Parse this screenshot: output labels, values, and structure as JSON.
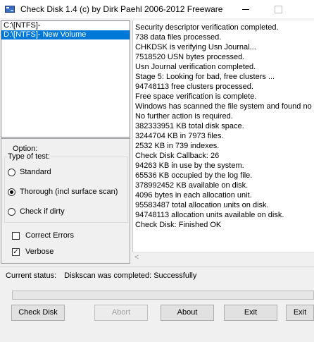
{
  "window": {
    "title": "Check Disk 1.4  (c) by Dirk Paehl  2006-2012 Freeware"
  },
  "drives": [
    {
      "label": "C:\\[NTFS]-",
      "selected": false
    },
    {
      "label": "D:\\[NTFS]- New Volume",
      "selected": true
    }
  ],
  "options": {
    "title": "Option:",
    "type_group_label": "Type of test:",
    "radios": [
      {
        "label": "Standard",
        "checked": false
      },
      {
        "label": "Thorough (incl surface scan)",
        "checked": true
      },
      {
        "label": "Check if dirty",
        "checked": false
      }
    ],
    "checkboxes": [
      {
        "label": "Correct Errors",
        "checked": false
      },
      {
        "label": "Verbose",
        "checked": true
      }
    ]
  },
  "log": [
    "Security descriptor verification completed.",
    "738 data files processed.",
    "CHKDSK is verifying Usn Journal...",
    "7518520 USN bytes processed.",
    "Usn Journal verification completed.",
    "Stage 5: Looking for bad, free clusters ...",
    "94748113 free clusters processed.",
    "Free space verification is complete.",
    "Windows has scanned the file system and found no",
    "No further action is required.",
    "382333951 KB total disk space.",
    "3244704 KB in 7973 files.",
    "2532 KB in 739 indexes.",
    "Check Disk Callback: 26",
    "94263 KB in use by the system.",
    "65536 KB occupied by the log file.",
    "378992452 KB available on disk.",
    "4096 bytes in each allocation unit.",
    "95583487 total allocation units on disk.",
    "94748113 allocation units available on disk.",
    "Check Disk: Finished OK"
  ],
  "status": {
    "label": "Current status:",
    "value": "Diskscan was completed: Successfully"
  },
  "progress": {
    "fraction": 0
  },
  "buttons": {
    "check_disk": "Check Disk",
    "abort": "Abort",
    "about": "About",
    "exit1": "Exit",
    "exit2": "Exit"
  },
  "colors": {
    "selection": "#0078d7"
  }
}
